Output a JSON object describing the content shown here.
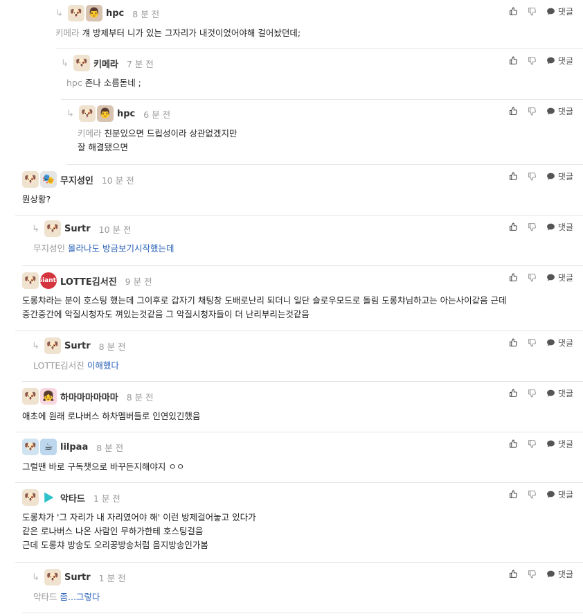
{
  "actions": {
    "reply_label": "댓글"
  },
  "comments": [
    {
      "nick": "hpc",
      "time": "8 분 전",
      "mention": "키메라",
      "text": "걔 방제부터 니가 있는 그자리가 내것이었어야해 걸어놨던데;"
    },
    {
      "nick": "키메라",
      "time": "7 분 전",
      "mention": "hpc",
      "text": "존나 소름돋네 ;"
    },
    {
      "nick": "hpc",
      "time": "6 분 전",
      "mention": "키메라",
      "text": "친분있으면 드립성이라 상관없겠지만",
      "text2": "잘 해결됐으면"
    },
    {
      "nick": "무지성인",
      "time": "10 분 전",
      "text": "뭔상황?"
    },
    {
      "nick": "Surtr",
      "time": "10 분 전",
      "mention": "무지성인",
      "text": "몰라나도 방금보기시작했는데"
    },
    {
      "nick": "LOTTE김서진",
      "time": "9 분 전",
      "text": "도롱챠라는 분이 호스팅 했는데 그이후로 갑자기 채팅창 도배로난리 되더니 일단 슬로우모드로 돌림 도롱챠님하고는 아는사이같음 근데",
      "text2": "중간중간에 악질시청자도 껴있는것같음 그 악질시청자들이 더 난리부리는것같음"
    },
    {
      "nick": "Surtr",
      "time": "8 분 전",
      "mention": "LOTTE김서진",
      "text": "이해했다"
    },
    {
      "nick": "하마마마마마마",
      "time": "8 분 전",
      "text": "애초에 원래 로나버스 하차멤버들로 인연있긴했음"
    },
    {
      "nick": "lilpaa",
      "time": "8 분 전",
      "text": "그럴땐 바로 구독챗으로 바꾸든지해야지 ㅇㅇ"
    },
    {
      "nick": "악타드",
      "time": "1 분 전",
      "text": "도롱챠가 '그 자리가 내 자리였어야 해' 이런 방제걸어놓고 있다가",
      "text2": "같은 로나버스 나온 사람인 무하가한테 호스팅걸음",
      "text3": "근데 도롱챠 방송도 오리꿍방송처럼 음지방송인가봄"
    },
    {
      "nick": "Surtr",
      "time": "1 분 전",
      "mention": "악타드",
      "text": "좀...그렇다"
    }
  ]
}
